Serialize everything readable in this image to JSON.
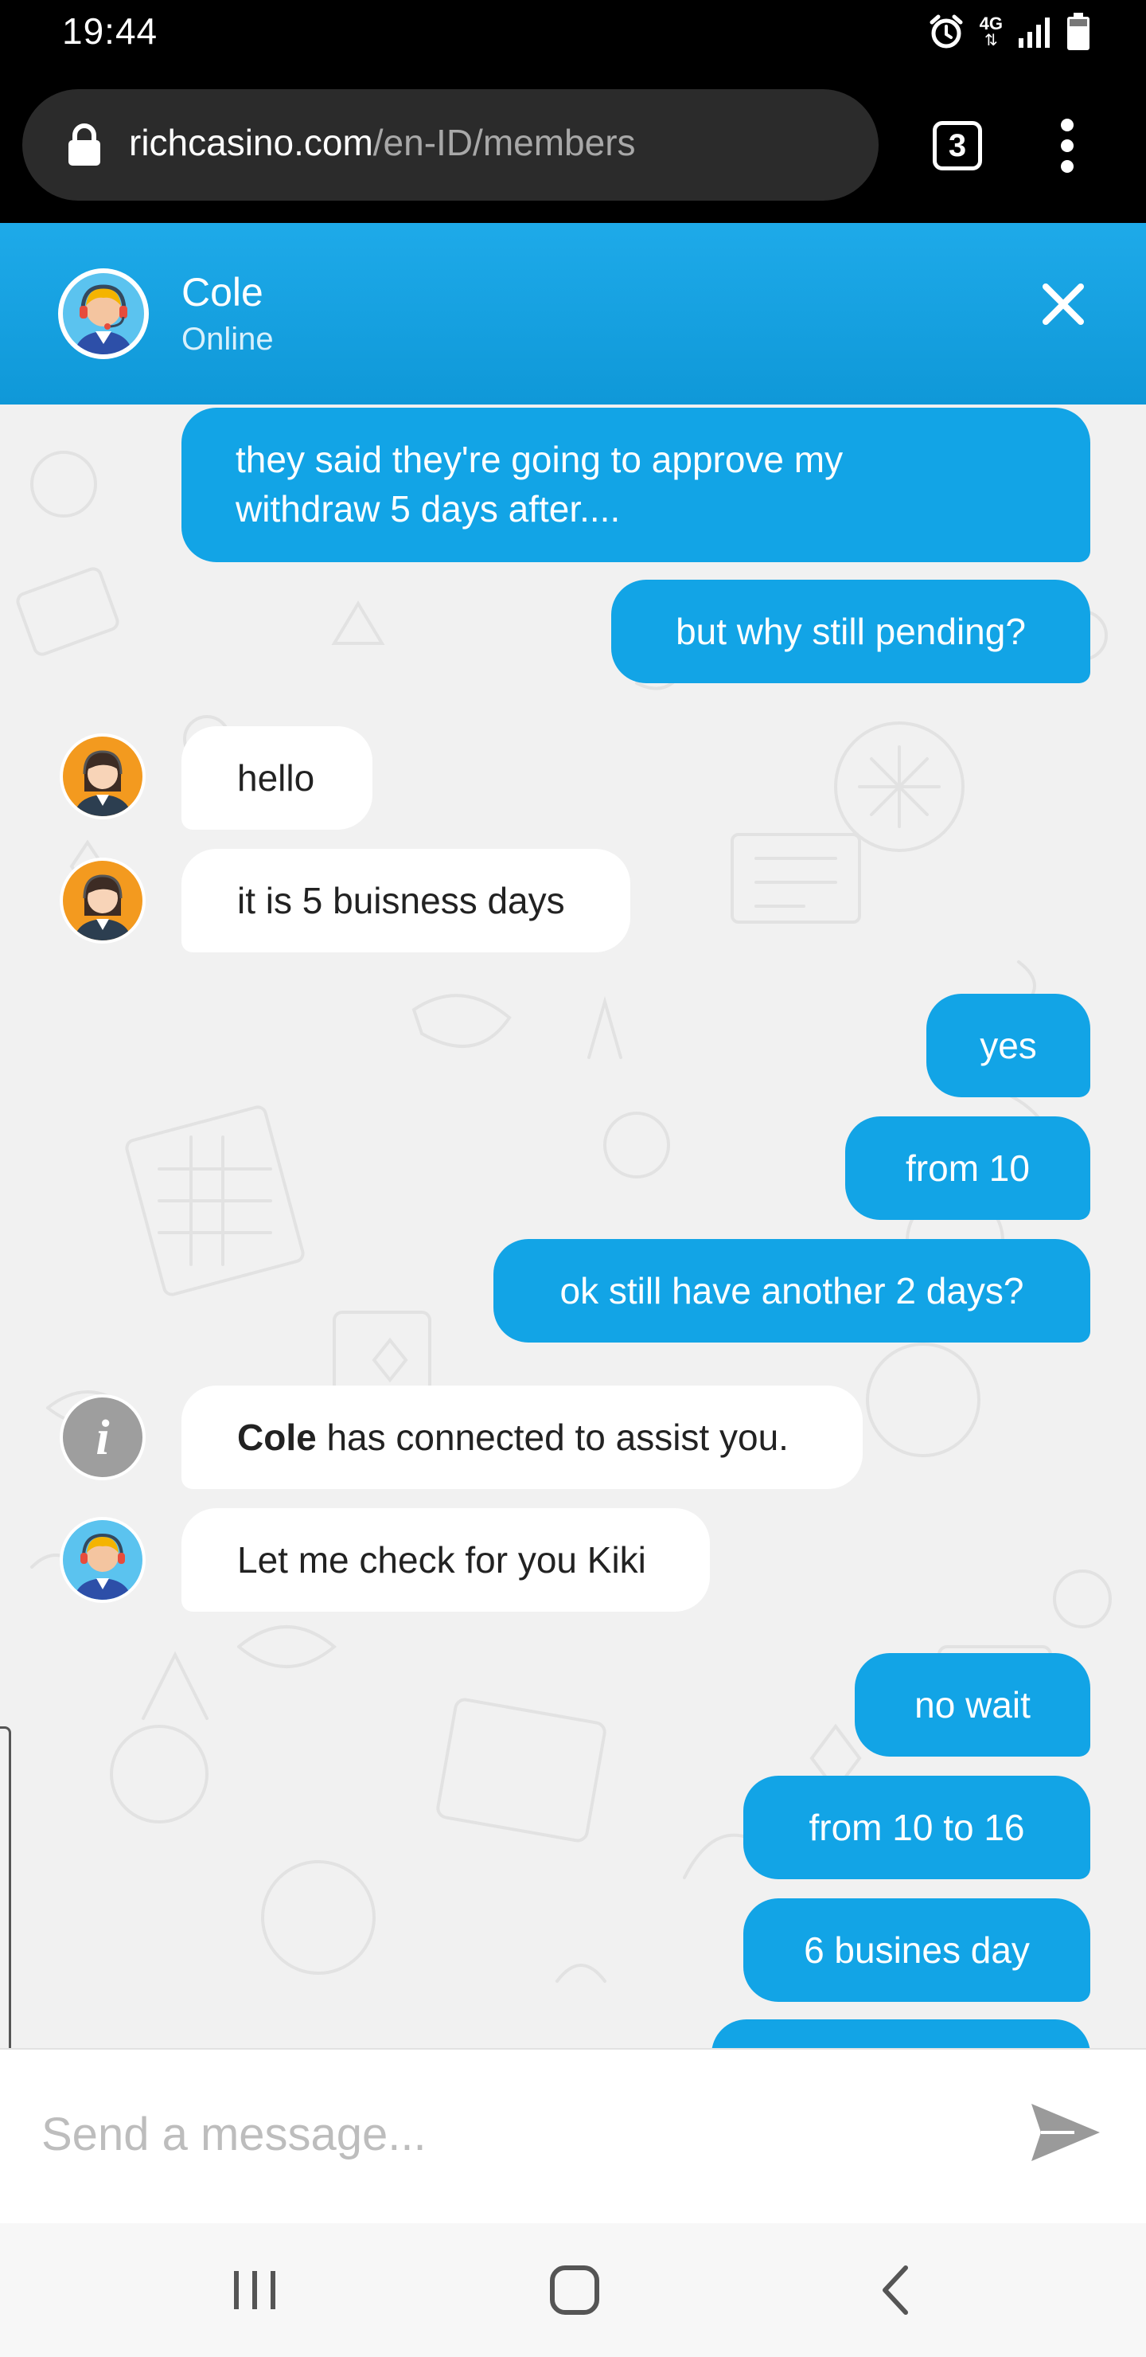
{
  "status_bar": {
    "time": "19:44",
    "network": "4G",
    "icons": [
      "alarm-icon",
      "network-4g-icon",
      "signal-icon",
      "battery-icon"
    ]
  },
  "browser": {
    "url_domain": "richcasino.com",
    "url_path": "/en-ID/members",
    "tab_count": "3",
    "icons": [
      "lock-icon",
      "menu-dots-icon"
    ]
  },
  "chat_header": {
    "agent_name": "Cole",
    "agent_status": "Online",
    "icons": [
      "agent-avatar-icon",
      "close-icon"
    ],
    "background_color": "#12a4e6"
  },
  "messages": [
    {
      "sender": "user",
      "lines": [
        "they said they're going to approve my",
        "withdraw 5 days after...."
      ]
    },
    {
      "sender": "user",
      "text": "but why still pending?"
    },
    {
      "sender": "agent",
      "avatar": "female-agent-avatar",
      "text": "hello"
    },
    {
      "sender": "agent",
      "avatar": "female-agent-avatar",
      "text": "it is 5 buisness days"
    },
    {
      "sender": "user",
      "text": "yes"
    },
    {
      "sender": "user",
      "text": "from 10"
    },
    {
      "sender": "user",
      "text": "ok still have another 2 days?"
    },
    {
      "sender": "system",
      "avatar": "info-icon",
      "bold": "Cole",
      "text": " has connected to assist you."
    },
    {
      "sender": "agent",
      "avatar": "male-agent-avatar",
      "text": "Let me check for you Kiki"
    },
    {
      "sender": "user",
      "text": "no wait"
    },
    {
      "sender": "user",
      "text": "from 10 to 16"
    },
    {
      "sender": "user",
      "text": "6 busines day"
    }
  ],
  "composer": {
    "placeholder": "Send a message...",
    "icons": [
      "send-icon"
    ]
  },
  "nav_bar": {
    "icons": [
      "recent-apps-icon",
      "home-icon",
      "back-icon"
    ]
  },
  "colors": {
    "user_bubble": "#12a4e6",
    "agent_bubble": "#ffffff",
    "chat_background": "#f1f1f1"
  }
}
